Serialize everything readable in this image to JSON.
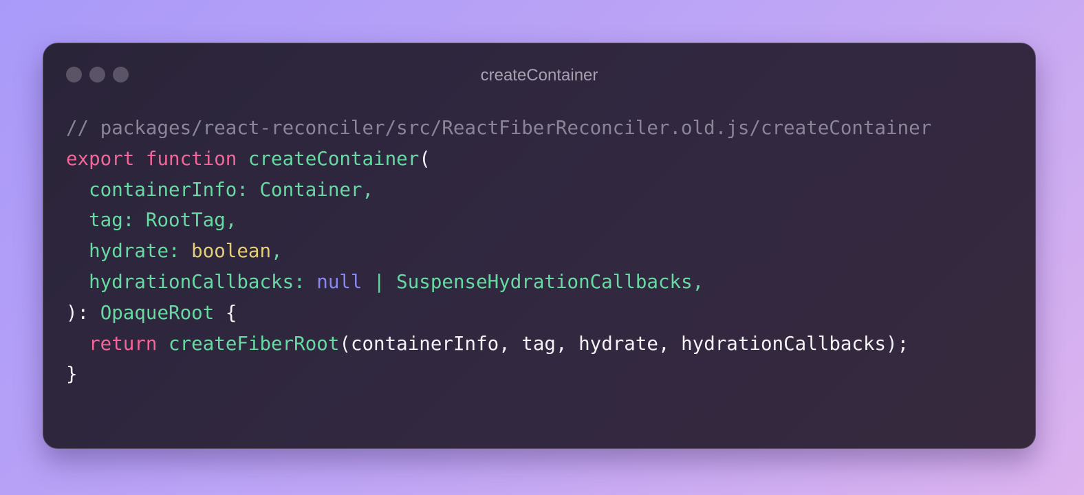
{
  "window": {
    "title": "createContainer"
  },
  "code": {
    "comment": "// packages/react-reconciler/src/ReactFiberReconciler.old.js/createContainer",
    "l2_kw_export": "export",
    "l2_sp1": " ",
    "l2_kw_function": "function",
    "l2_sp2": " ",
    "l2_fn": "createContainer",
    "l2_paren": "(",
    "l3_indent": "  ",
    "l3_prop": "containerInfo:",
    "l3_sp": " ",
    "l3_type": "Container",
    "l3_comma": ",",
    "l4_indent": "  ",
    "l4_prop": "tag:",
    "l4_sp": " ",
    "l4_type": "RootTag",
    "l4_comma": ",",
    "l5_indent": "  ",
    "l5_prop": "hydrate:",
    "l5_sp": " ",
    "l5_type": "boolean",
    "l5_comma": ",",
    "l6_indent": "  ",
    "l6_prop": "hydrationCallbacks:",
    "l6_sp1": " ",
    "l6_null": "null",
    "l6_pipe": " | ",
    "l6_type": "SuspenseHydrationCallbacks",
    "l6_comma": ",",
    "l7_close": "):",
    "l7_sp": " ",
    "l7_type": "OpaqueRoot",
    "l7_brace": " {",
    "l8_indent": "  ",
    "l8_kw": "return",
    "l8_sp": " ",
    "l8_fn": "createFiberRoot",
    "l8_args": "(containerInfo, tag, hydrate, hydrationCallbacks);",
    "l9_brace": "}"
  },
  "colors": {
    "keyword": "#f3669a",
    "function": "#68d9a3",
    "boolean": "#e4cf78",
    "null": "#8a86f2",
    "comment": "#8b8598",
    "text": "#f4f2f7"
  }
}
